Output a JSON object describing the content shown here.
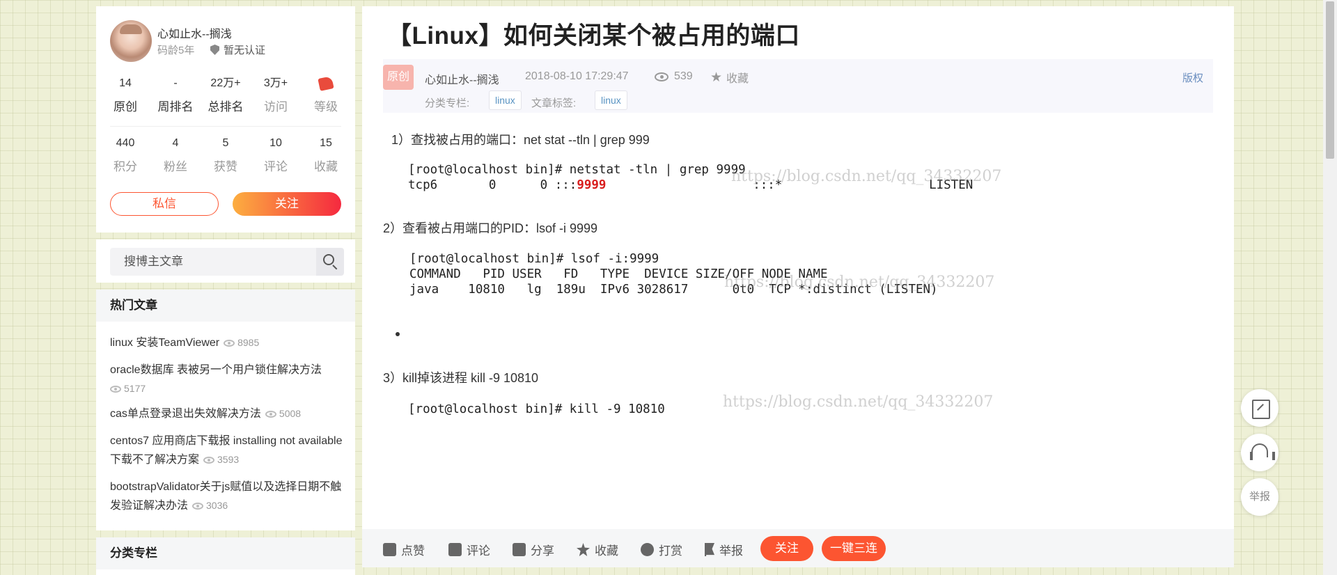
{
  "profile": {
    "name": "心如止水--搁浅",
    "code_age": "码龄5年",
    "cert": "暂无认证",
    "stats_row1": [
      {
        "value": "14",
        "label": "原创"
      },
      {
        "value": "-",
        "label": "周排名"
      },
      {
        "value": "22万+",
        "label": "总排名"
      },
      {
        "value": "3万+",
        "label": "访问"
      },
      {
        "value": "",
        "label": "等级"
      }
    ],
    "stats_row2": [
      {
        "value": "440",
        "label": "积分"
      },
      {
        "value": "4",
        "label": "粉丝"
      },
      {
        "value": "5",
        "label": "获赞"
      },
      {
        "value": "10",
        "label": "评论"
      },
      {
        "value": "15",
        "label": "收藏"
      }
    ],
    "message_label": "私信",
    "follow_label": "关注"
  },
  "search": {
    "placeholder": "搜博主文章"
  },
  "hot": {
    "title": "热门文章",
    "items": [
      {
        "title": "linux 安装TeamViewer",
        "views": "8985"
      },
      {
        "title": "oracle数据库 表被另一个用户锁住解决方法",
        "views": "5177"
      },
      {
        "title": "cas单点登录退出失效解决方法",
        "views": "5008"
      },
      {
        "title": "centos7 应用商店下载报 installing not available 下载不了解决方案",
        "views": "3593"
      },
      {
        "title": "bootstrapValidator关于js赋值以及选择日期不触发验证解决办法",
        "views": "3036"
      }
    ]
  },
  "categories": {
    "title": "分类专栏"
  },
  "article": {
    "title": "【Linux】如何关闭某个被占用的端口",
    "badge": "原创",
    "author": "心如止水--搁浅",
    "date": "2018-08-10 17:29:47",
    "views": "539",
    "fav_label": "收藏",
    "copyright": "版权",
    "category_label": "分类专栏:",
    "category_tag": "linux",
    "tag_label": "文章标签:",
    "tag": "linux",
    "step1": "1）查找被占用的端口：net stat --tln | grep 999",
    "code1_line1": "[root@localhost bin]# netstat -tln | grep 9999",
    "code1_line2_pre": "tcp6       0      0 :::",
    "code1_port": "9999",
    "code1_line2_post": "                    :::*                    LISTEN",
    "step2": "2）查看被占用端口的PID：lsof -i 9999",
    "code2_line1": "[root@localhost bin]# lsof -i:9999",
    "code2_line2": "COMMAND   PID USER   FD   TYPE  DEVICE SIZE/OFF NODE NAME",
    "code2_line3": "java    10810   lg  189u  IPv6 3028617      0t0  TCP *:distinct (LISTEN)",
    "step3": "3）kill掉该进程  kill -9 10810",
    "code3_line1": "[root@localhost bin]# kill -9 10810",
    "watermark": "https://blog.csdn.net/qq_34332207"
  },
  "actions": {
    "like": "点赞",
    "comment": "评论",
    "share": "分享",
    "collect": "收藏",
    "reward": "打赏",
    "report": "举报",
    "follow": "关注",
    "triple": "一键三连"
  },
  "float_tools": {
    "report": "举报"
  }
}
